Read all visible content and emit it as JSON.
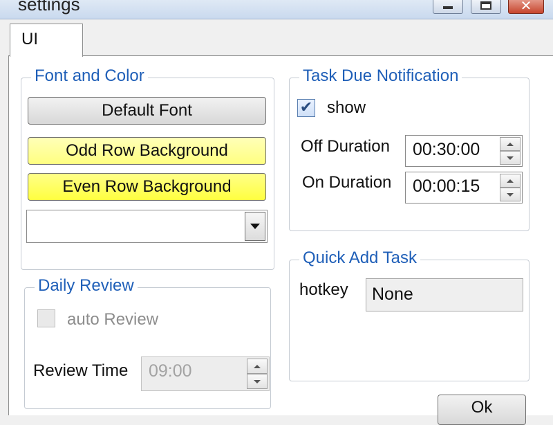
{
  "window": {
    "title": "settings",
    "close_glyph": "✕"
  },
  "tabs": [
    {
      "label": "UI"
    }
  ],
  "font_and_color": {
    "title": "Font and Color",
    "default_font_label": "Default Font",
    "odd_row_label": "Odd Row Background",
    "even_row_label": "Even Row Background",
    "odd_row_color": "#ffff9c",
    "even_row_color": "#ffff55",
    "dropdown_value": ""
  },
  "daily_review": {
    "title": "Daily Review",
    "auto_review_label": "auto Review",
    "auto_review_checked": false,
    "review_time_label": "Review Time",
    "review_time_value": "09:00"
  },
  "task_due": {
    "title": "Task Due Notification",
    "show_label": "show",
    "show_checked": true,
    "check_glyph": "✔",
    "off_duration_label": "Off Duration",
    "off_duration_value": "00:30:00",
    "on_duration_label": "On Duration",
    "on_duration_value": "00:00:15"
  },
  "quick_add": {
    "title": "Quick Add Task",
    "hotkey_label": "hotkey",
    "hotkey_value": "None"
  },
  "footer": {
    "ok_label": "Ok"
  },
  "colors": {
    "group_title": "#1f5fb8",
    "titlebar": "#c9d9ee",
    "close_button": "#c7462e"
  },
  "icons": [
    "minimize-icon",
    "maximize-icon",
    "close-icon",
    "dropdown-arrow-icon",
    "checkmark-icon",
    "spin-up-icon",
    "spin-down-icon"
  ]
}
